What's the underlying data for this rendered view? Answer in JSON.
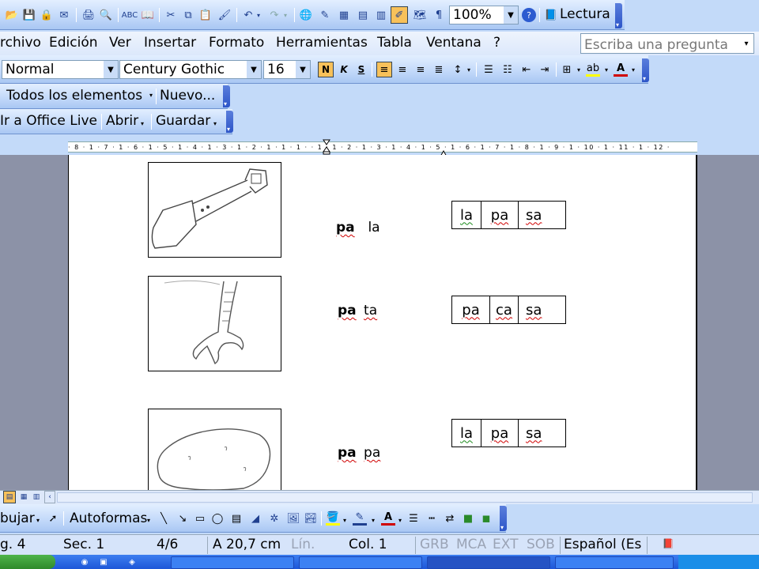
{
  "standard_toolbar": {
    "zoom": "100%",
    "reading_label": "Lectura"
  },
  "menu": {
    "items": [
      "rchivo",
      "Edición",
      "Ver",
      "Insertar",
      "Formato",
      "Herramientas",
      "Tabla",
      "Ventana",
      "?"
    ],
    "help_placeholder": "Escriba una pregunta"
  },
  "format_toolbar": {
    "style": "Normal",
    "font": "Century Gothic",
    "size": "16",
    "bold_glyph": "N",
    "italic_glyph": "K",
    "underline_glyph": "S"
  },
  "reviewing_toolbar": {
    "all_items": "Todos los elementos",
    "new_label": "Nuevo..."
  },
  "web_toolbar": {
    "office_live": "Ir a Office Live",
    "open": "Abrir",
    "save": "Guardar"
  },
  "ruler": {
    "labels": "· 8 · 1 · 7 · 1 · 6 · 1 · 5 · 1 · 4 · 1 · 3 · 1 · 2 · 1 · 1 · 1 ·   · 1 · 1 · 2 · 1 · 3 · 1 · 4 · 1 · 5 · 1 · 6 · 1 · 7 · 1 · 8 · 1 · 9 · 1 · 10 · 1 · 11 · 1 · 12 ·"
  },
  "document": {
    "rows": [
      {
        "picture": "shovel",
        "word_bold": "pa",
        "word_rest": "la",
        "syllables": [
          "la",
          "pa",
          "sa"
        ]
      },
      {
        "picture": "chicken-foot",
        "word_bold": "pa",
        "word_rest": "ta",
        "syllables": [
          "pa",
          "ca",
          "sa"
        ]
      },
      {
        "picture": "potato",
        "word_bold": "pa",
        "word_rest": "pa",
        "syllables": [
          "la",
          "pa",
          "sa"
        ]
      }
    ]
  },
  "drawing_toolbar": {
    "draw": "bujar",
    "autoshapes": "Autoformas"
  },
  "status_bar": {
    "page": "g. 4",
    "section": "Sec. 1",
    "pages": "4/6",
    "at": "A 20,7 cm",
    "line": "Lín.",
    "col": "Col. 1",
    "grb": "GRB",
    "mca": "MCA",
    "ext": "EXT",
    "sob": "SOB",
    "language": "Español (Es"
  },
  "colors": {
    "toolbar_blue": "#c4dafa",
    "page_bg": "#ffffff",
    "gutter": "#8c92a7",
    "taskbar": "#1d57d8"
  }
}
